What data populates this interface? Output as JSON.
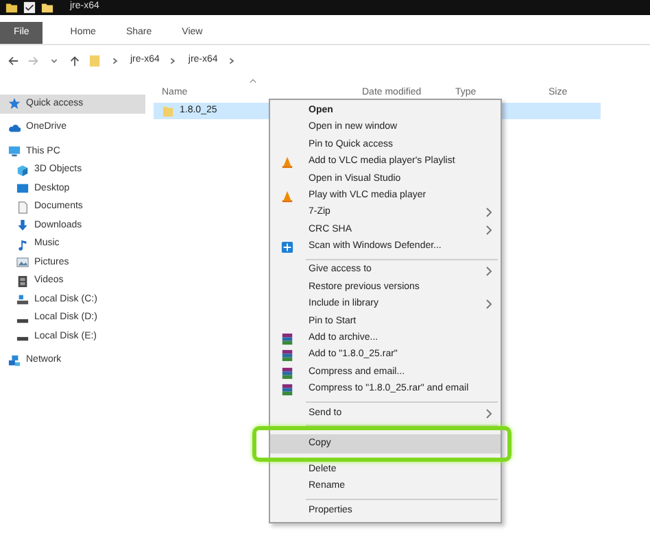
{
  "window": {
    "title": "jre-x64"
  },
  "ribbon_tabs": [
    {
      "label": "File",
      "kind": "file",
      "selected": false
    },
    {
      "label": "Home",
      "kind": "tab",
      "selected": false
    },
    {
      "label": "Share",
      "kind": "tab",
      "selected": false
    },
    {
      "label": "View",
      "kind": "tab",
      "selected": false
    }
  ],
  "address": {
    "segments": [
      "jre-x64",
      "jre-x64"
    ]
  },
  "sidebar": {
    "items": [
      {
        "label": "Quick access",
        "kind": "star",
        "selected": true
      },
      {
        "label": "OneDrive",
        "kind": "cloud",
        "selected": false
      },
      {
        "label": "This PC",
        "kind": "pc",
        "selected": false,
        "children": [
          {
            "label": "3D Objects",
            "kind": "cube",
            "selected": false
          },
          {
            "label": "Desktop",
            "kind": "desktop",
            "selected": false
          },
          {
            "label": "Documents",
            "kind": "document",
            "selected": false
          },
          {
            "label": "Downloads",
            "kind": "download",
            "selected": false
          },
          {
            "label": "Music",
            "kind": "music",
            "selected": false
          },
          {
            "label": "Pictures",
            "kind": "picture",
            "selected": false
          },
          {
            "label": "Videos",
            "kind": "video",
            "selected": false
          },
          {
            "label": "Local Disk (C:)",
            "kind": "system-disk",
            "selected": false
          },
          {
            "label": "Local Disk (D:)",
            "kind": "disk",
            "selected": false
          },
          {
            "label": "Local Disk (E:)",
            "kind": "disk",
            "selected": false
          }
        ]
      },
      {
        "label": "Network",
        "kind": "network",
        "selected": false
      }
    ]
  },
  "columns": [
    {
      "label": "Name",
      "sorted": true
    },
    {
      "label": "Date modified",
      "sorted": false
    },
    {
      "label": "Type",
      "sorted": false
    },
    {
      "label": "Size",
      "sorted": false
    }
  ],
  "files": [
    {
      "name": "1.8.0_25",
      "selected": true
    }
  ],
  "context_menu": {
    "sections": [
      [
        {
          "label": "Open",
          "kind": "plain",
          "bold": true,
          "submenu": false,
          "highlighted": false
        },
        {
          "label": "Open in new window",
          "kind": "plain",
          "bold": false,
          "submenu": false,
          "highlighted": false
        },
        {
          "label": "Pin to Quick access",
          "kind": "plain",
          "bold": false,
          "submenu": false,
          "highlighted": false
        },
        {
          "label": "Add to VLC media player's Playlist",
          "kind": "vlc",
          "bold": false,
          "submenu": false,
          "highlighted": false
        },
        {
          "label": "Open in Visual Studio",
          "kind": "plain",
          "bold": false,
          "submenu": false,
          "highlighted": false
        },
        {
          "label": "Play with VLC media player",
          "kind": "vlc",
          "bold": false,
          "submenu": false,
          "highlighted": false
        },
        {
          "label": "7-Zip",
          "kind": "plain",
          "bold": false,
          "submenu": true,
          "highlighted": false
        },
        {
          "label": "CRC SHA",
          "kind": "plain",
          "bold": false,
          "submenu": true,
          "highlighted": false
        },
        {
          "label": "Scan with Windows Defender...",
          "kind": "defender",
          "bold": false,
          "submenu": false,
          "highlighted": false
        }
      ],
      [
        {
          "label": "Give access to",
          "kind": "plain",
          "bold": false,
          "submenu": true,
          "highlighted": false
        },
        {
          "label": "Restore previous versions",
          "kind": "plain",
          "bold": false,
          "submenu": false,
          "highlighted": false
        },
        {
          "label": "Include in library",
          "kind": "plain",
          "bold": false,
          "submenu": true,
          "highlighted": false
        },
        {
          "label": "Pin to Start",
          "kind": "plain",
          "bold": false,
          "submenu": false,
          "highlighted": false
        },
        {
          "label": "Add to archive...",
          "kind": "rar",
          "bold": false,
          "submenu": false,
          "highlighted": false
        },
        {
          "label": "Add to \"1.8.0_25.rar\"",
          "kind": "rar",
          "bold": false,
          "submenu": false,
          "highlighted": false
        },
        {
          "label": "Compress and email...",
          "kind": "rar",
          "bold": false,
          "submenu": false,
          "highlighted": false
        },
        {
          "label": "Compress to \"1.8.0_25.rar\" and email",
          "kind": "rar",
          "bold": false,
          "submenu": false,
          "highlighted": false
        }
      ],
      [
        {
          "label": "Send to",
          "kind": "plain",
          "bold": false,
          "submenu": true,
          "highlighted": false
        }
      ],
      [
        {
          "label": "Copy",
          "kind": "plain",
          "bold": false,
          "submenu": false,
          "highlighted": true
        },
        {
          "label": "Delete",
          "kind": "plain",
          "bold": false,
          "submenu": false,
          "highlighted": false
        },
        {
          "label": "Rename",
          "kind": "plain",
          "bold": false,
          "submenu": false,
          "highlighted": false
        }
      ],
      [
        {
          "label": "Properties",
          "kind": "plain",
          "bold": false,
          "submenu": false,
          "highlighted": false
        }
      ]
    ]
  }
}
